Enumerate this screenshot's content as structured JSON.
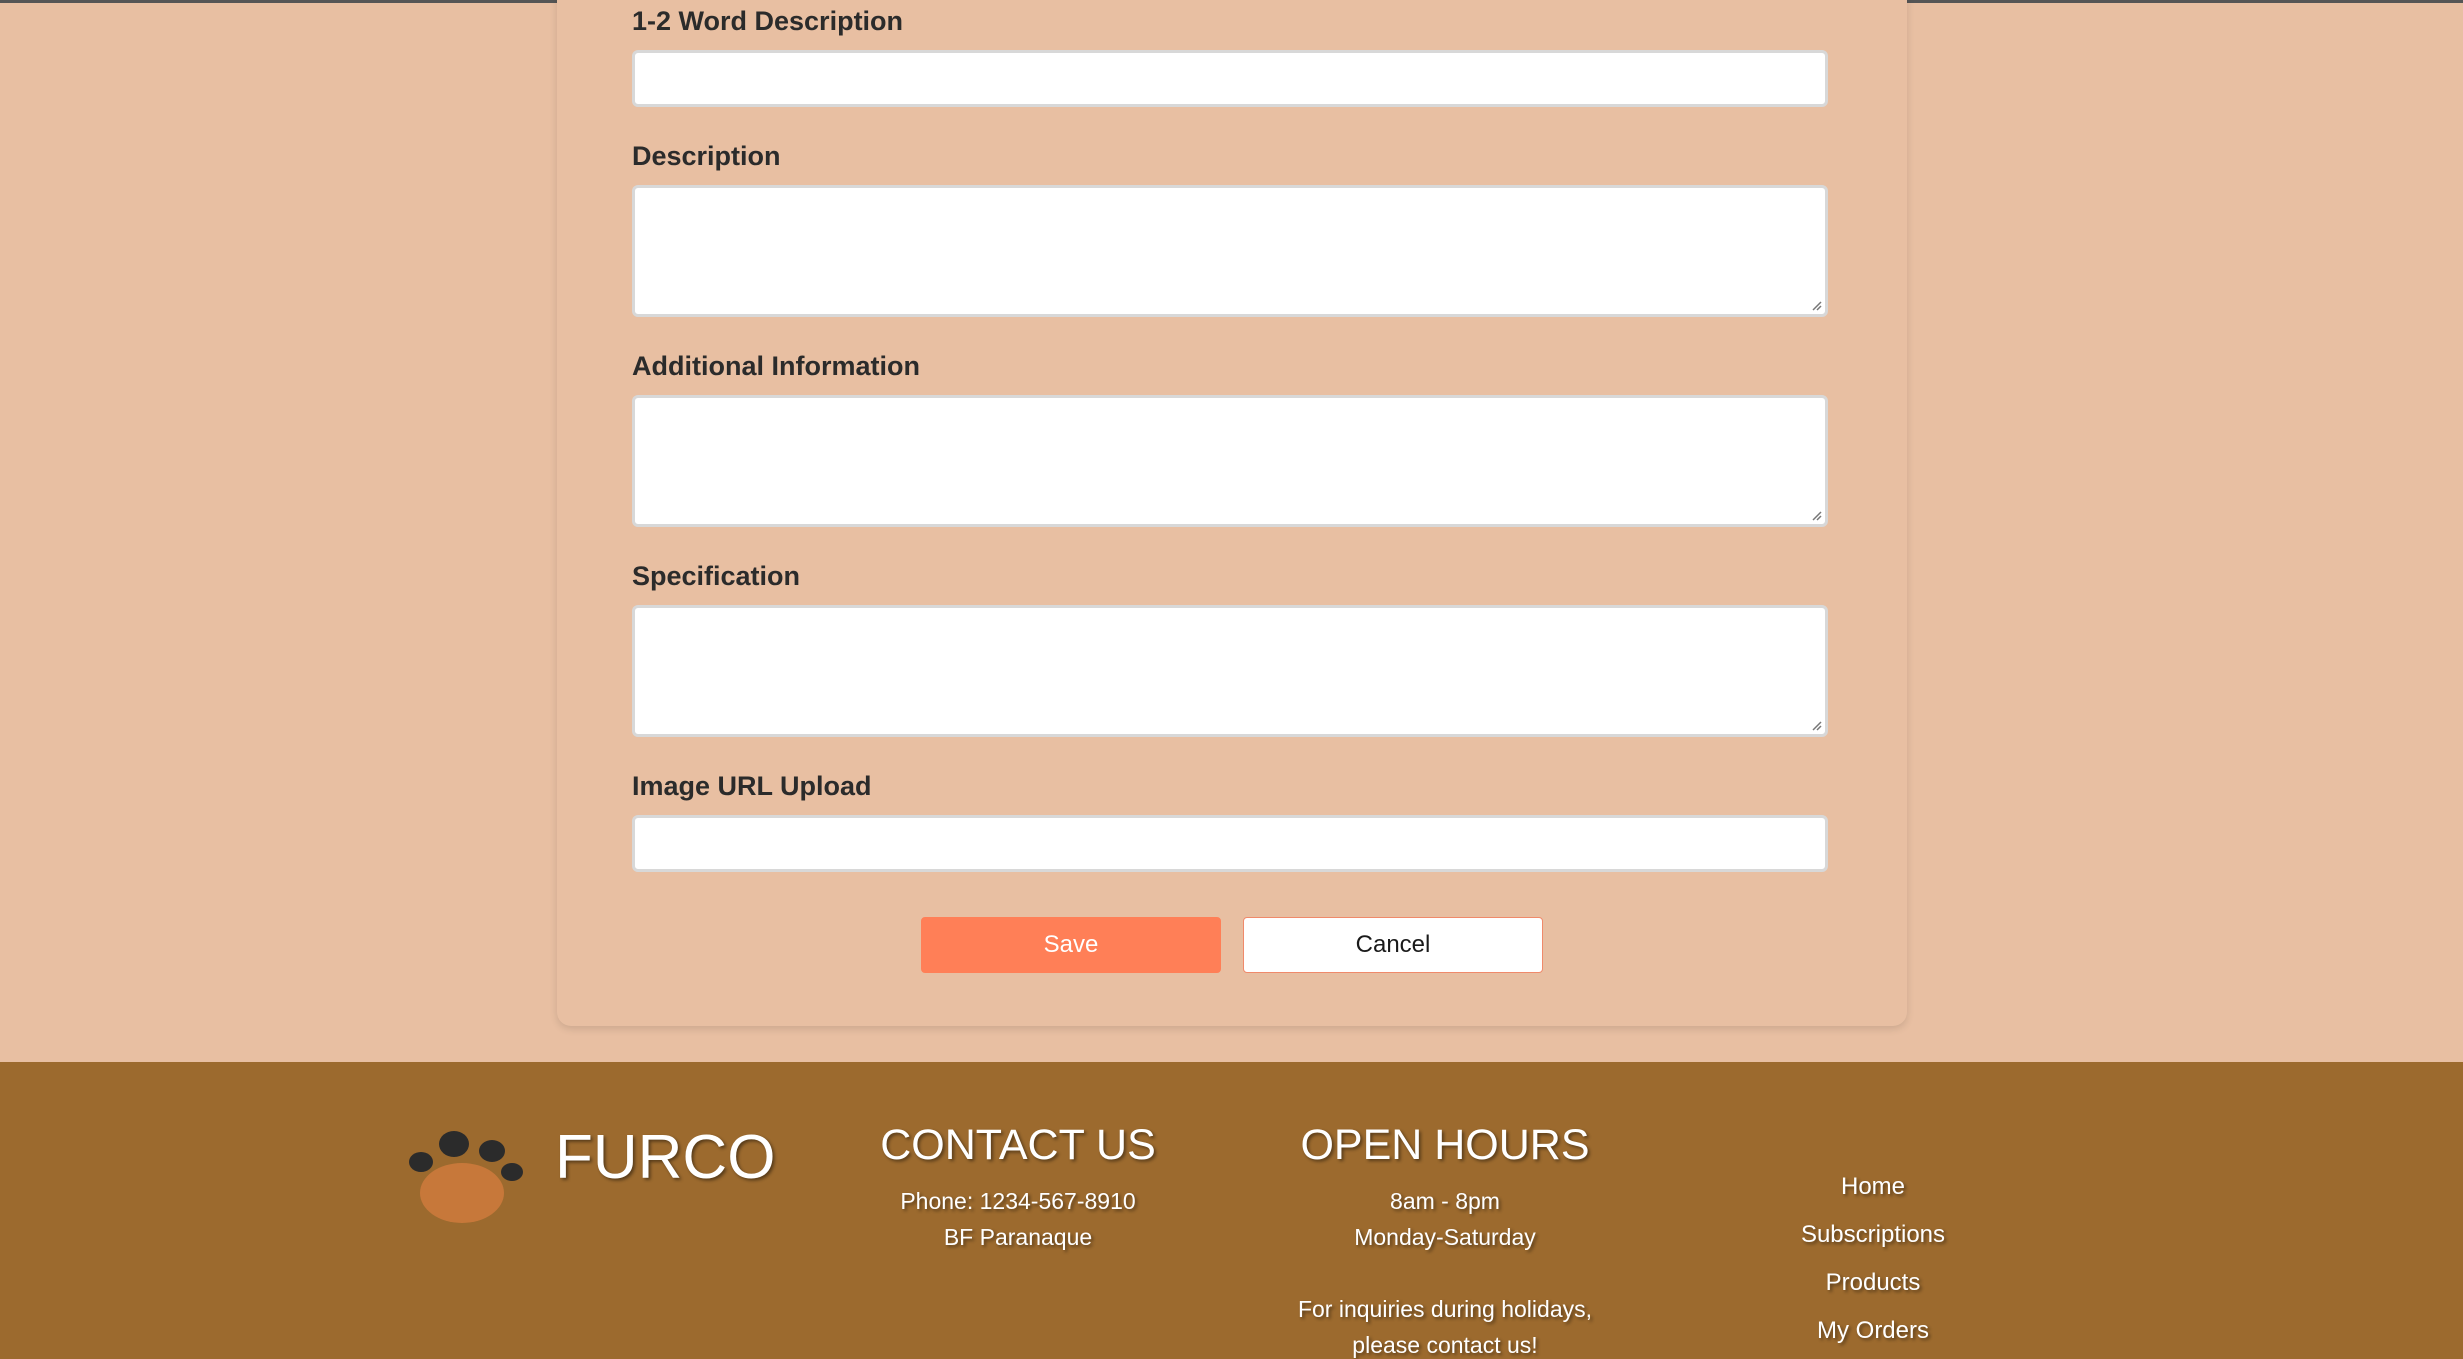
{
  "form": {
    "fields": [
      {
        "label": "1-2 Word Description",
        "type": "input",
        "value": ""
      },
      {
        "label": "Description",
        "type": "textarea",
        "value": ""
      },
      {
        "label": "Additional Information",
        "type": "textarea",
        "value": ""
      },
      {
        "label": "Specification",
        "type": "textarea",
        "value": ""
      },
      {
        "label": "Image URL Upload",
        "type": "input",
        "value": ""
      }
    ],
    "save_label": "Save",
    "cancel_label": "Cancel",
    "save_color": "#ff7f57"
  },
  "footer": {
    "brand": "FURCO",
    "logo_icon": "paw-icon",
    "contact": {
      "heading": "CONTACT US",
      "phone": "Phone: 1234-567-8910",
      "address": "BF Paranaque"
    },
    "hours": {
      "heading": "OPEN HOURS",
      "time": "8am - 8pm",
      "days": "Monday-Saturday",
      "note_line1": "For inquiries during holidays,",
      "note_line2": "please contact us!"
    },
    "nav": [
      "Home",
      "Subscriptions",
      "Products",
      "My Orders"
    ],
    "background_color": "#9c6a2e"
  },
  "page_background_color": "#e8bfa2"
}
